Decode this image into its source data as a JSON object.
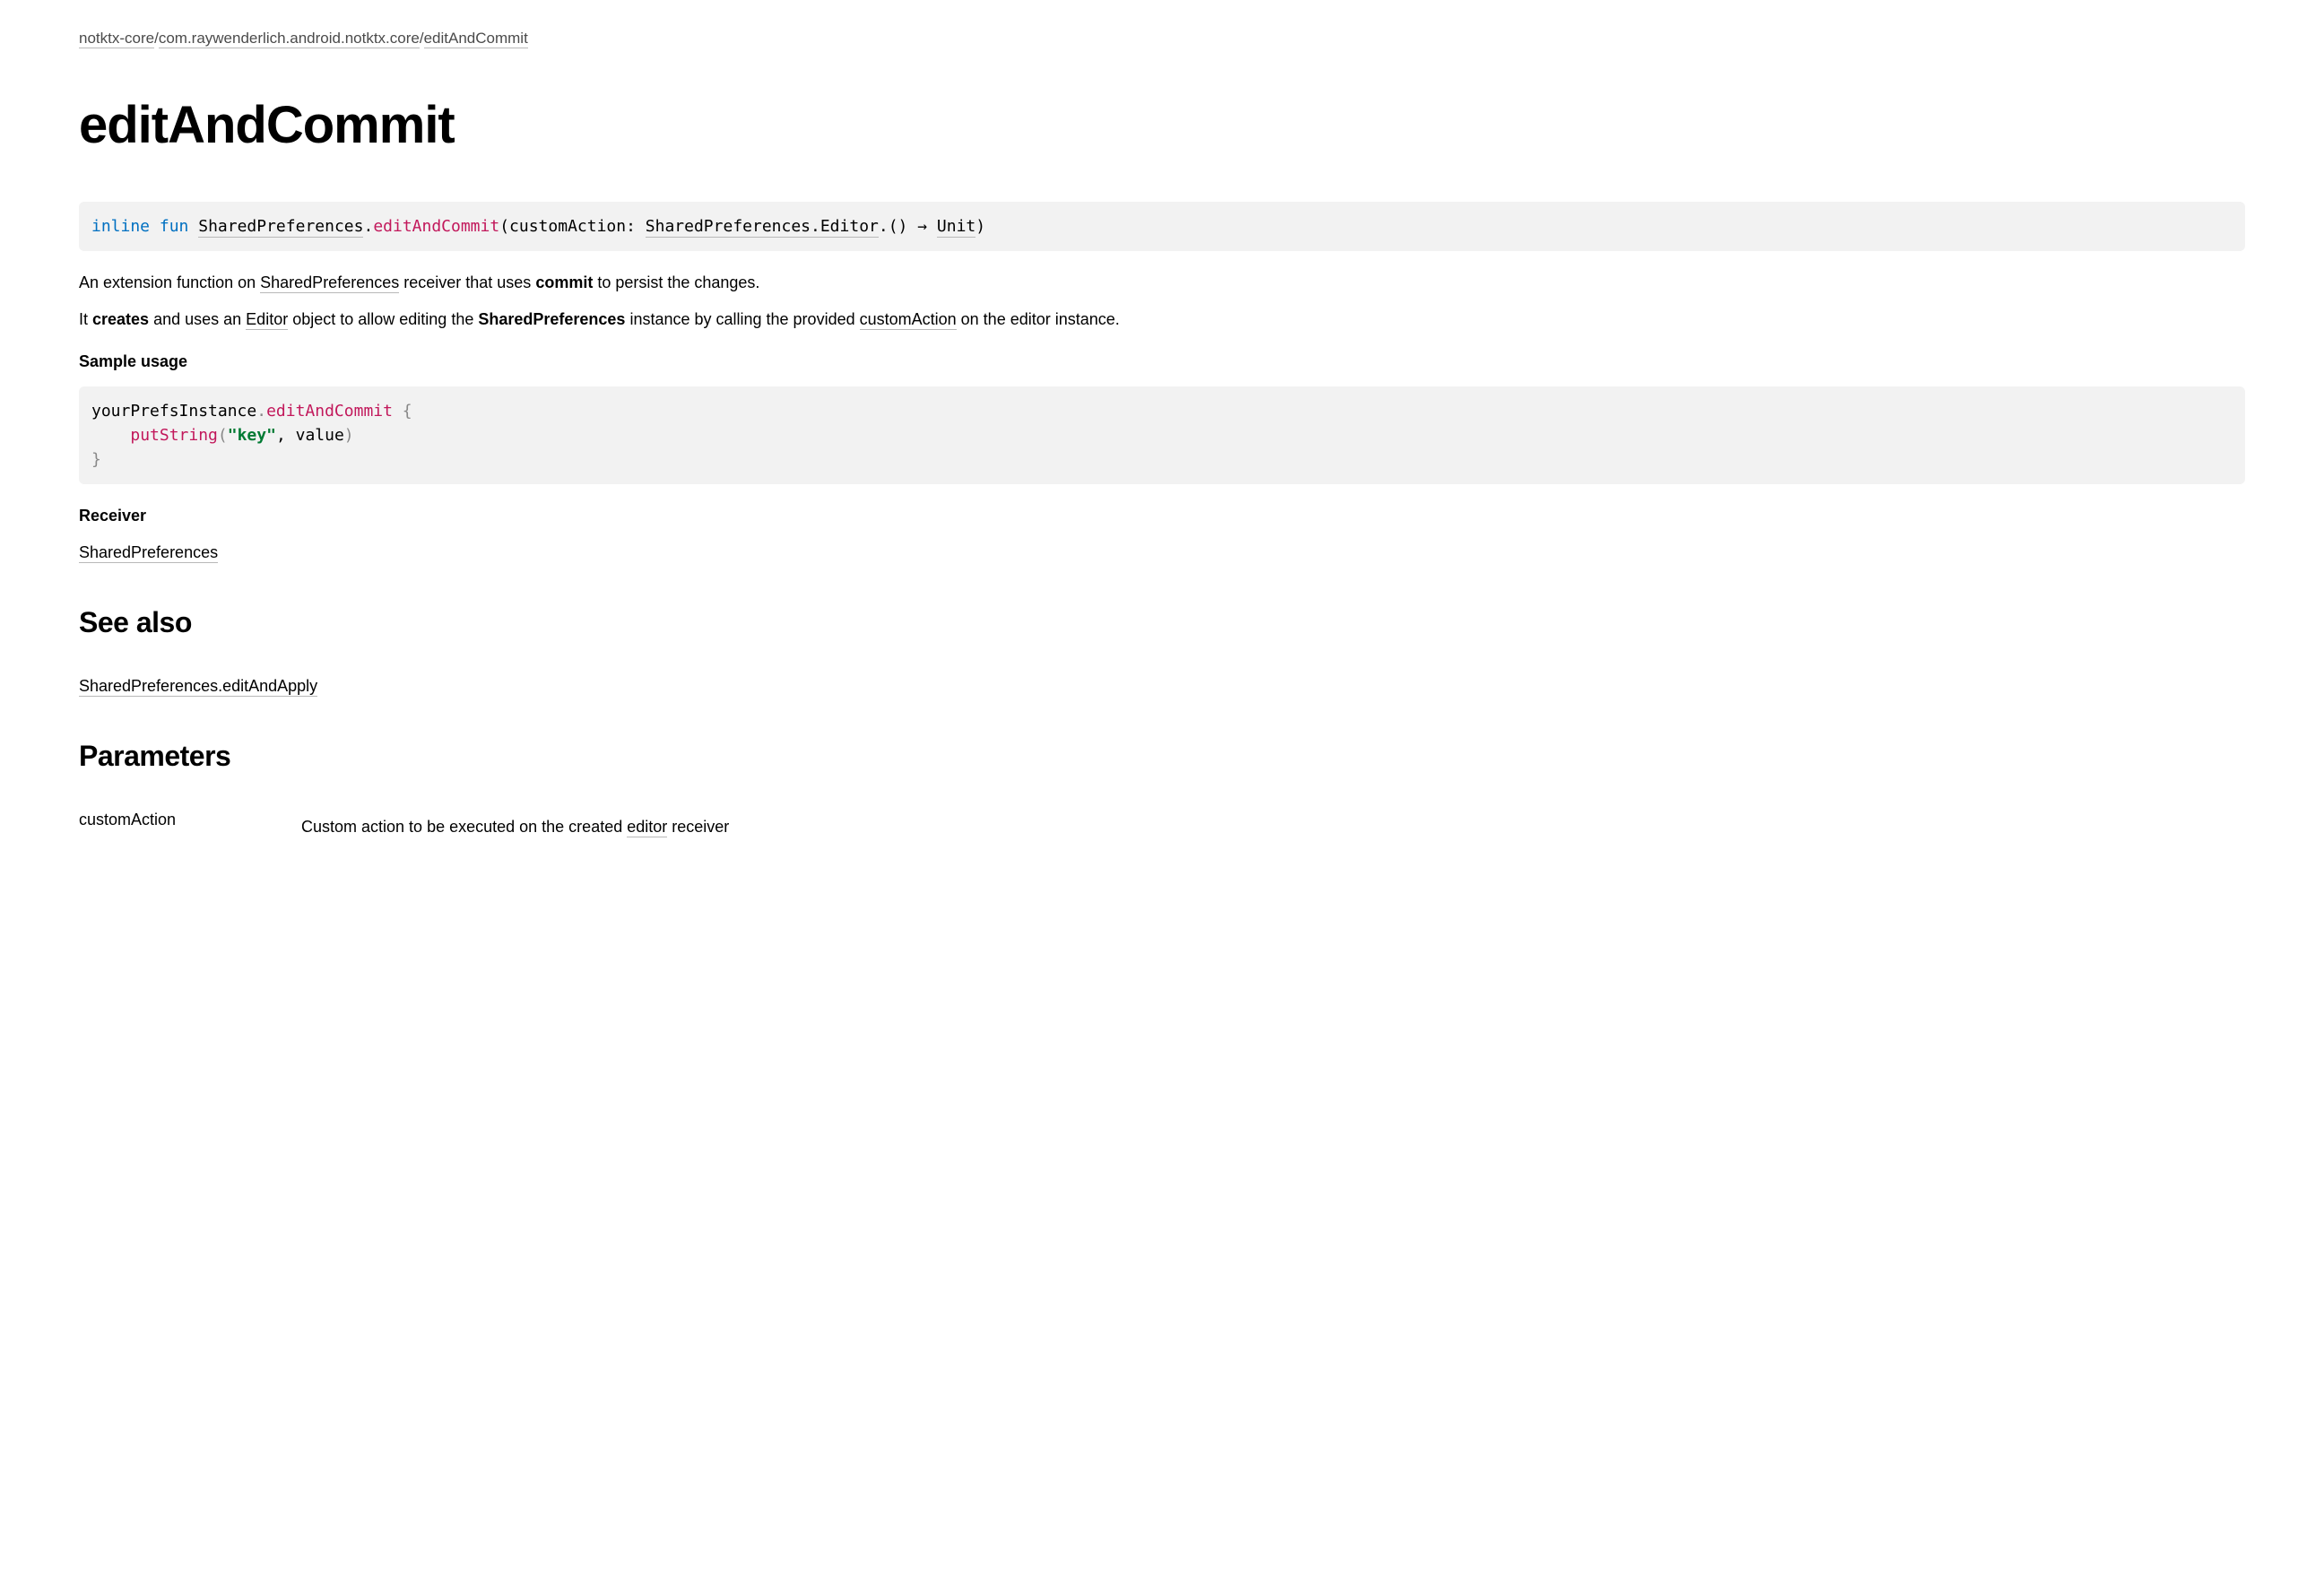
{
  "breadcrumb": {
    "items": [
      {
        "label": "notktx-core"
      },
      {
        "label": "com.raywenderlich.android.notktx.core"
      },
      {
        "label": "editAndCommit"
      }
    ],
    "sep": "/"
  },
  "title": "editAndCommit",
  "signature": {
    "inline": "inline",
    "fun": "fun",
    "receiver": "SharedPreferences",
    "dot": ".",
    "name": "editAndCommit",
    "lparen": "(",
    "param": "customAction",
    "colon": ": ",
    "paramType": "SharedPreferences.Editor",
    "afterType": ".() ",
    "arrow": "→",
    "space": " ",
    "ret": "Unit",
    "rparen": ")"
  },
  "desc1": {
    "t1": "An extension function on ",
    "link1": "SharedPreferences",
    "t2": " receiver that uses ",
    "bold1": "commit",
    "t3": " to persist the changes."
  },
  "desc2": {
    "t1": "It ",
    "bold1": "creates",
    "t2": " and uses an ",
    "link1": "Editor",
    "t3": " object to allow editing the ",
    "bold2": "SharedPreferences",
    "t4": " instance by calling the provided ",
    "link2": "customAction",
    "t5": " on the editor instance."
  },
  "sampleLabel": "Sample usage",
  "sample": {
    "l1a": "yourPrefsInstance",
    "l1b": ".",
    "l1c": "editAndCommit",
    "l1d": " {",
    "l2a": "    ",
    "l2b": "putString",
    "l2c": "(",
    "l2d": "\"key\"",
    "l2e": ", value",
    "l2f": ")",
    "l3": "}"
  },
  "receiverLabel": "Receiver",
  "receiverLink": "SharedPreferences",
  "seeAlsoHeading": "See also",
  "seeAlsoLink": "SharedPreferences.editAndApply",
  "parametersHeading": "Parameters",
  "params": {
    "name": "customAction",
    "desc1": "Custom action to be executed on the created ",
    "descLink": "editor",
    "desc2": " receiver"
  }
}
